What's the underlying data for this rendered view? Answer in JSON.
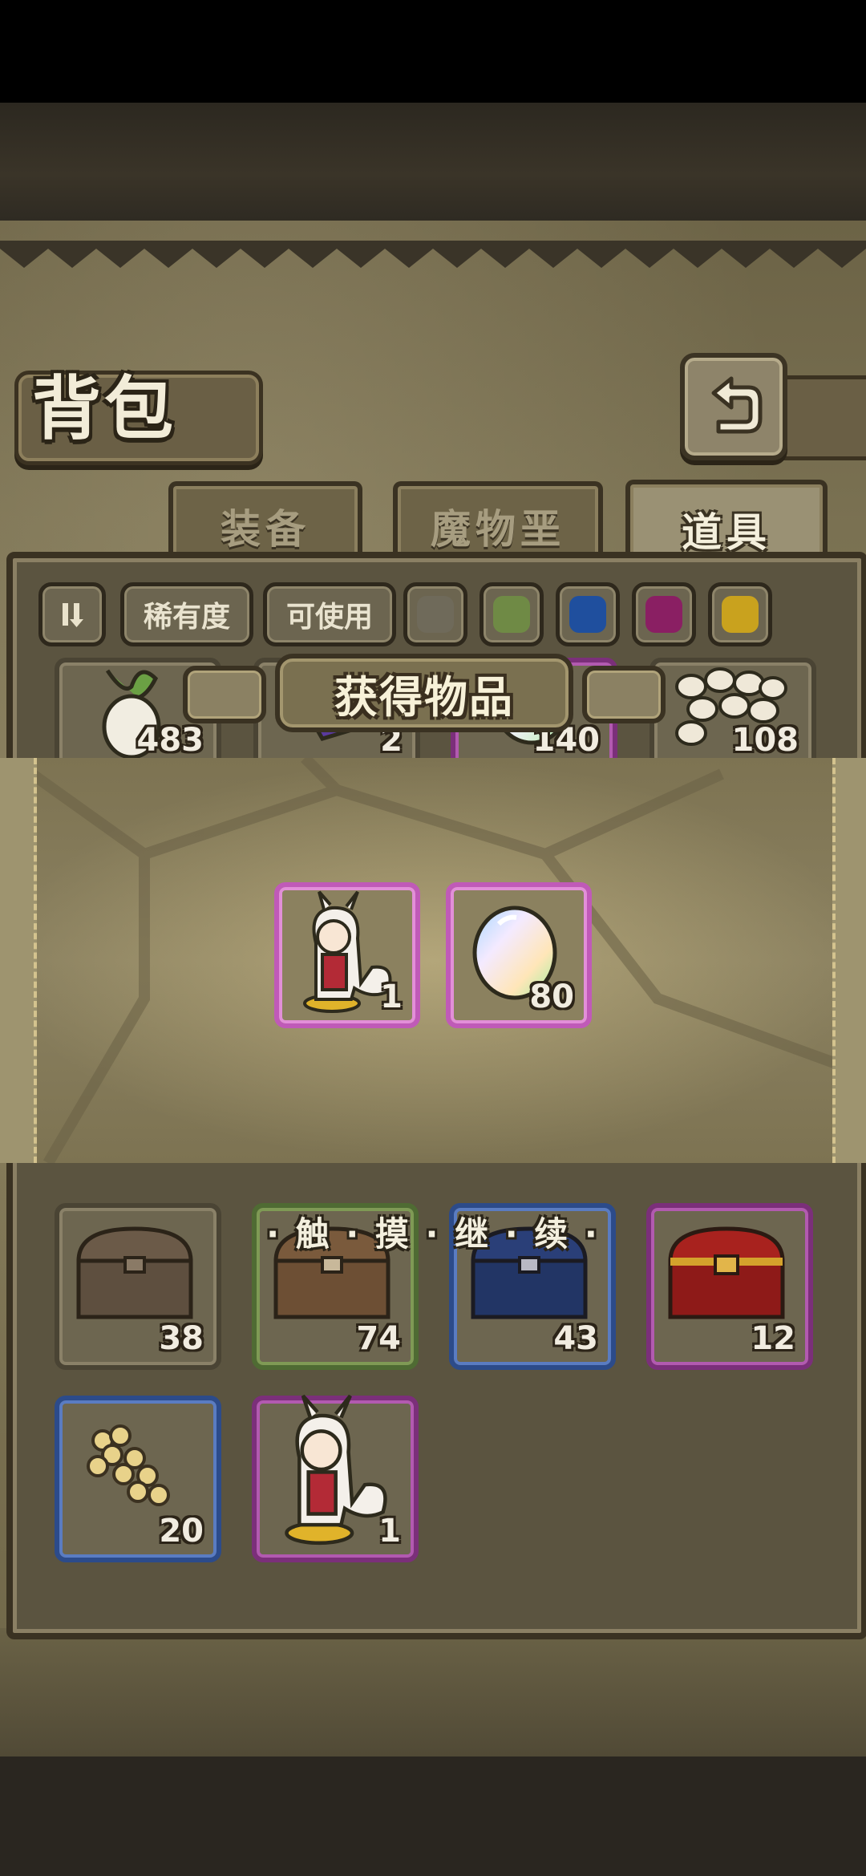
{
  "header": {
    "title": "背包"
  },
  "tabs": [
    {
      "label": "装备",
      "active": false
    },
    {
      "label": "魔物垩",
      "active": false
    },
    {
      "label": "道具",
      "active": true
    }
  ],
  "filters": {
    "rarity_label": "稀有度",
    "usable_label": "可使用",
    "swatch_colors": [
      "#6f6a5a",
      "#6f8a45",
      "#1f4f9e",
      "#8a1f63",
      "#c9a21e"
    ]
  },
  "rewards": {
    "title": "获得物品",
    "items": [
      {
        "icon": "white-haired-character-figure-icon",
        "count": "1",
        "rarity": "pink"
      },
      {
        "icon": "rainbow-egg-icon",
        "count": "80",
        "rarity": "pink"
      }
    ],
    "continue_hint": "· 触 · 摸 · 继 · 续 ·"
  },
  "inventory": {
    "partial_row": [
      {
        "icon": "radish-icon",
        "count": "483"
      },
      {
        "icon": "purple-crystal-icon",
        "count": "2"
      },
      {
        "icon": "rainbow-egg-icon",
        "count": "140"
      },
      {
        "icon": "eggs-pile-icon",
        "count": "108"
      }
    ],
    "row2": [
      {
        "icon": "wooden-chest-icon",
        "count": "38",
        "rarity": "gray"
      },
      {
        "icon": "wooden-chest-icon",
        "count": "74",
        "rarity": "green"
      },
      {
        "icon": "blue-chest-icon",
        "count": "43",
        "rarity": "blue"
      },
      {
        "icon": "red-chest-icon",
        "count": "12",
        "rarity": "purple"
      }
    ],
    "row3": [
      {
        "icon": "yellow-flowers-icon",
        "count": "20",
        "rarity": "blue"
      },
      {
        "icon": "white-haired-character-figure-icon",
        "count": "1",
        "rarity": "purple"
      }
    ]
  }
}
